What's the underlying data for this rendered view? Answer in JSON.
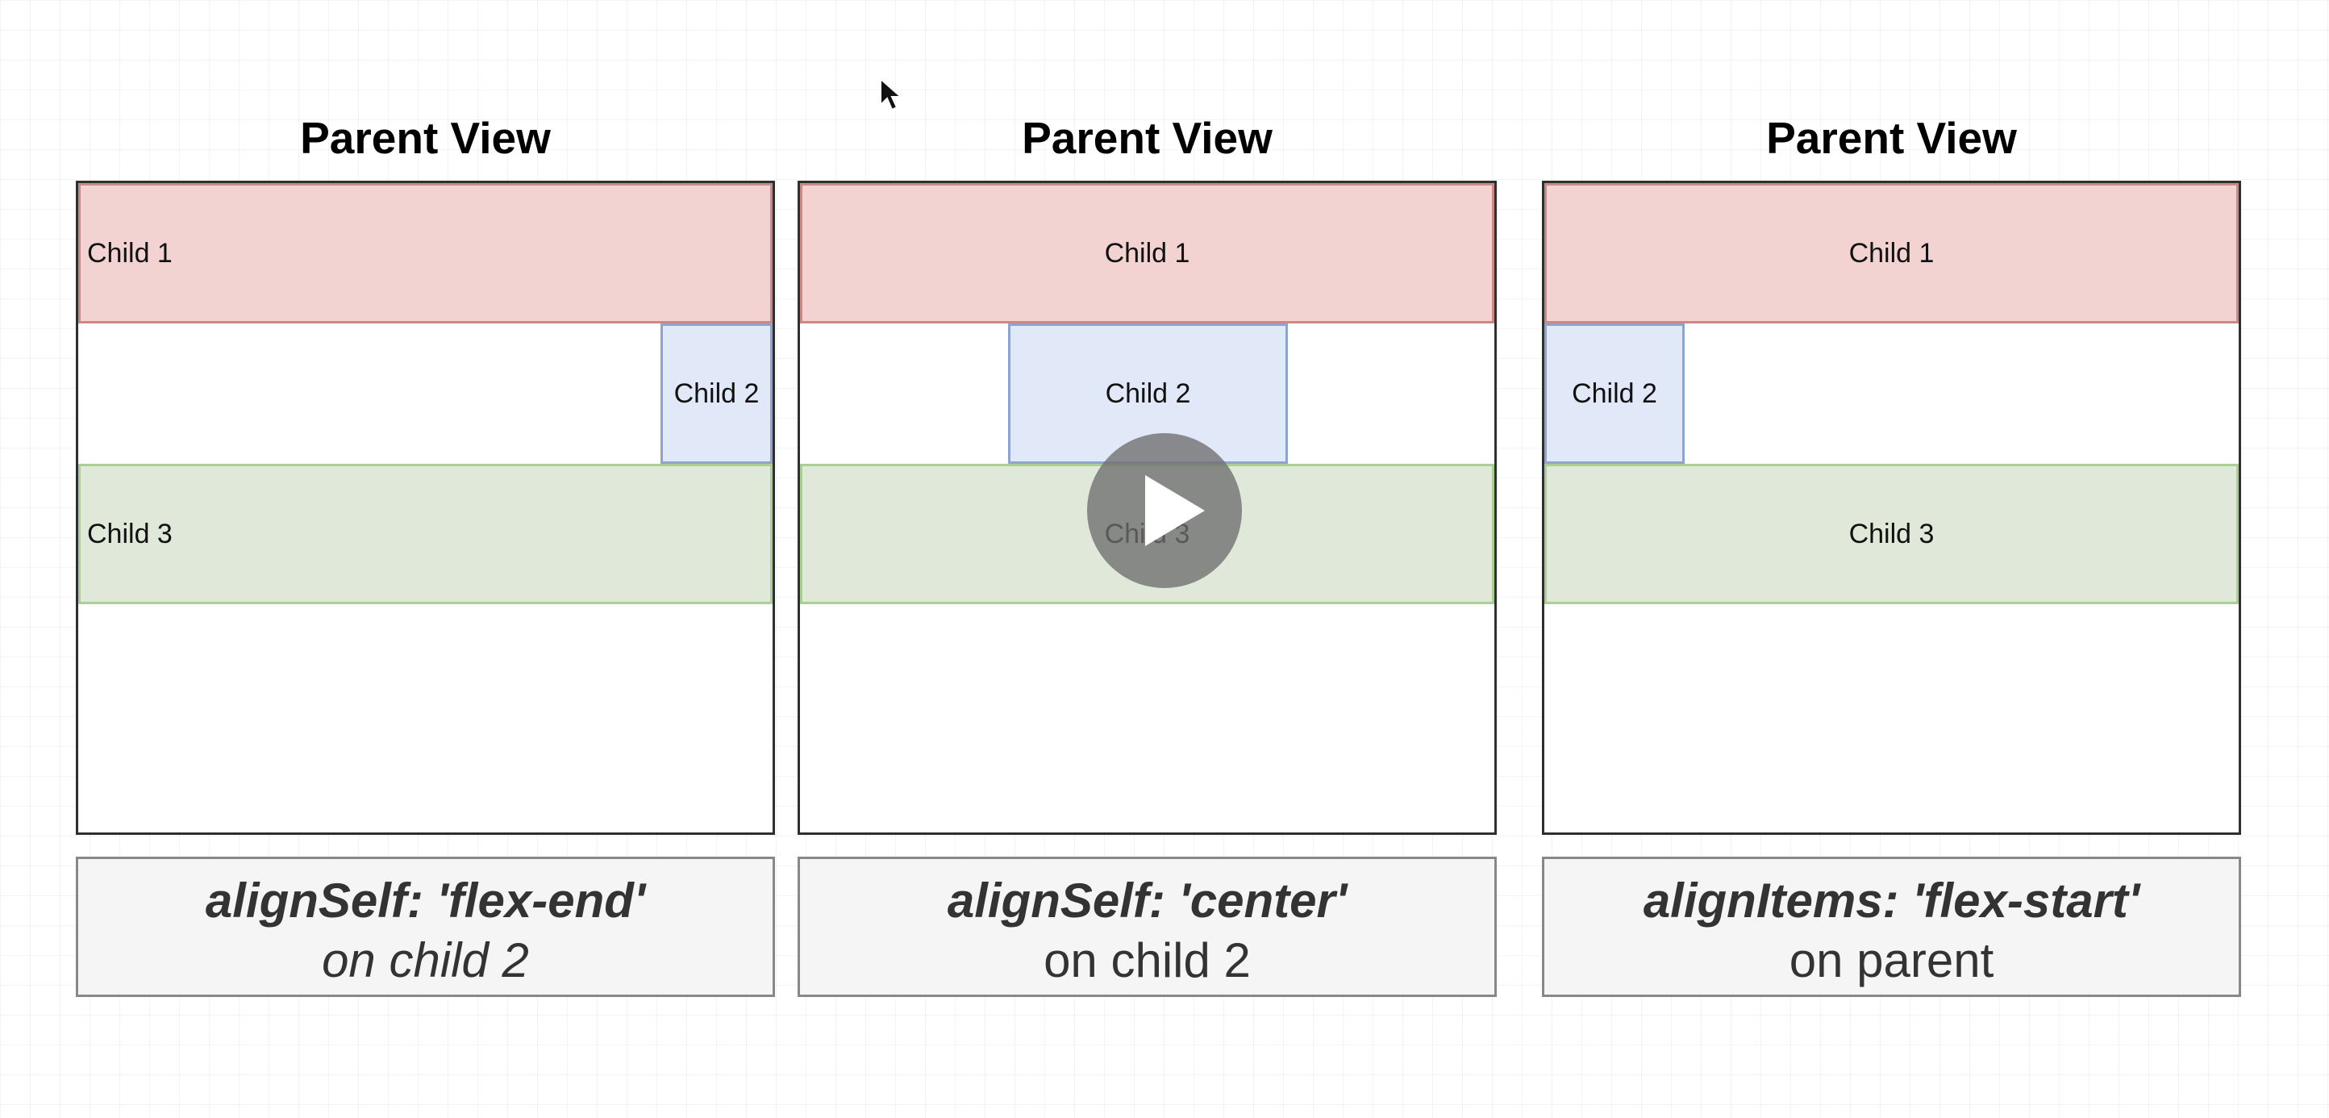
{
  "panels": [
    {
      "title": "Parent View",
      "children": [
        "Child 1",
        "Child 2",
        "Child 3"
      ],
      "caption": {
        "line1": "alignSelf: 'flex-end'",
        "line2": "on child 2"
      }
    },
    {
      "title": "Parent View",
      "children": [
        "Child 1",
        "Child 2",
        "Child 3"
      ],
      "caption": {
        "line1": "alignSelf: 'center'",
        "line2": "on child 2"
      }
    },
    {
      "title": "Parent View",
      "children": [
        "Child 1",
        "Child 2",
        "Child 3"
      ],
      "caption": {
        "line1": "alignItems: 'flex-start'",
        "line2": "on parent"
      }
    }
  ],
  "colors": {
    "child1_fill": "#f2d3d1",
    "child1_border": "#c98a86",
    "child2_fill": "#e1e9f8",
    "child2_border": "#8fa3cf",
    "child3_fill": "#e0e9d9",
    "child3_border": "#a9cf94",
    "caption_fill": "#f5f5f5"
  },
  "icons": {
    "play": "play-icon",
    "cursor": "mouse-cursor-icon"
  }
}
